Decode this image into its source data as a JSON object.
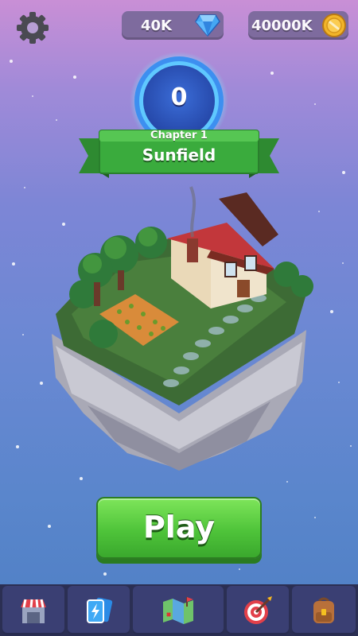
{
  "currency": {
    "gems": "40K",
    "coins": "40000K"
  },
  "level": {
    "value": "0"
  },
  "chapter": {
    "label": "Chapter 1",
    "name": "Sunfield"
  },
  "play_button": {
    "label": "Play"
  },
  "bottom_nav": {
    "items": [
      {
        "icon": "shop-icon"
      },
      {
        "icon": "cards-icon"
      },
      {
        "icon": "map-icon"
      },
      {
        "icon": "target-icon"
      },
      {
        "icon": "backpack-icon"
      }
    ]
  },
  "colors": {
    "play_green": "#4fc43a",
    "banner_green": "#3aab3d",
    "ring_blue": "#3d8ff0",
    "nav_bg": "#2b2f53"
  }
}
